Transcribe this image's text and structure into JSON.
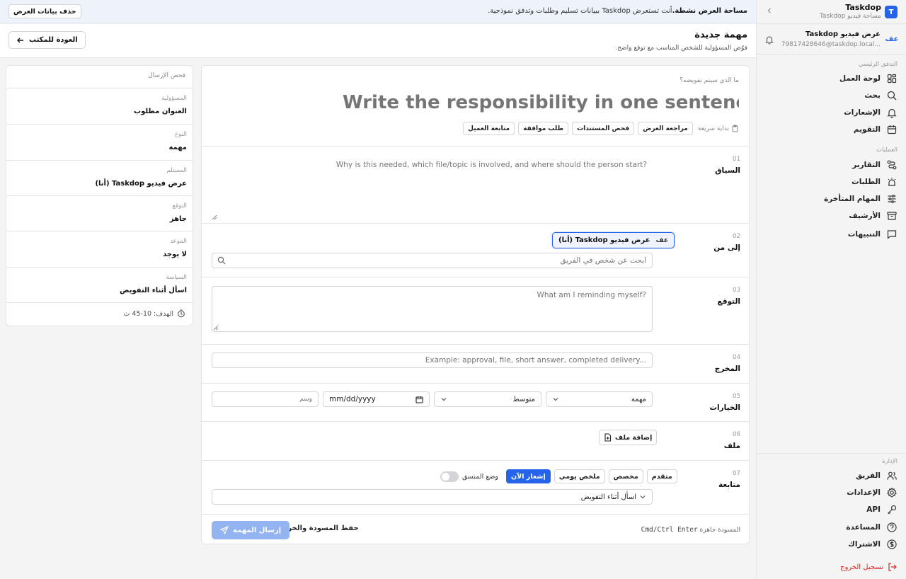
{
  "brand": {
    "initial": "T",
    "name": "Taskdop",
    "subtitle": "مساحة فيديو Taskdop"
  },
  "user": {
    "initials": "عف",
    "name": "عرض فيديو Taskdop",
    "email": "79817428646@taskdop.local..."
  },
  "sidebar": {
    "section_main": "التدفق الرئيسي",
    "main_items": [
      {
        "label": "لوحة العمل",
        "icon": "dashboard-icon"
      },
      {
        "label": "بحث",
        "icon": "search-icon"
      },
      {
        "label": "الإشعارات",
        "icon": "bell-icon"
      },
      {
        "label": "التقويم",
        "icon": "calendar-icon"
      }
    ],
    "section_ops": "العمليات",
    "ops_items": [
      {
        "label": "التقارير",
        "icon": "route-icon"
      },
      {
        "label": "الطلبات",
        "icon": "alarm-icon"
      },
      {
        "label": "المهام المتأخرة",
        "icon": "sliders-icon"
      },
      {
        "label": "الأرشيف",
        "icon": "archive-icon"
      },
      {
        "label": "التنبيهات",
        "icon": "message-icon"
      }
    ],
    "section_admin": "الإدارة",
    "admin_items": [
      {
        "label": "الفريق",
        "icon": "users-icon"
      },
      {
        "label": "الإعدادات",
        "icon": "gear-icon"
      },
      {
        "label": "API",
        "icon": "key-icon"
      },
      {
        "label": "المساعدة",
        "icon": "help-icon"
      },
      {
        "label": "الاشتراك",
        "icon": "dollar-icon"
      }
    ],
    "logout": "تسجيل الخروج"
  },
  "banner": {
    "title": "مساحة العرض نشطة.",
    "text": "أنت تستعرض Taskdop ببيانات تسليم وطلبات وتدفق نموذجية.",
    "clear_button": "حذف بيانات العرض"
  },
  "header": {
    "title": "مهمة جديدة",
    "subtitle": "فوّض المسؤولية للشخص المناسب مع توقع واضح.",
    "back_button": "العودة للمكتب"
  },
  "form": {
    "question": "ما الذي سيتم تفويضه؟",
    "title_placeholder": "Write the responsibility in one sentence...",
    "quick_start_label": "بداية سريعة",
    "quick_chips": [
      "مراجعة العرض",
      "فحص المستندات",
      "طلب موافقة",
      "متابعة العميل"
    ],
    "context": {
      "num": "01",
      "label": "السياق",
      "placeholder": "Why is this needed, which file/topic is involved, and where should the person start?"
    },
    "to": {
      "num": "02",
      "label": "إلى من",
      "selected_initials": "عف",
      "selected_name": "عرض فيديو Taskdop (أنا)",
      "search_placeholder": "ابحث عن شخص في الفريق"
    },
    "expectation": {
      "num": "03",
      "label": "التوقع",
      "placeholder": "What am I reminding myself?"
    },
    "output": {
      "num": "04",
      "label": "المخرج",
      "placeholder": "Example: approval, file, short answer, completed delivery..."
    },
    "options": {
      "num": "05",
      "label": "الخيارات",
      "type_value": "مهمة",
      "priority_value": "متوسط",
      "date_placeholder": "mm/dd/yyyy",
      "tag_placeholder": "وسم"
    },
    "file": {
      "num": "06",
      "label": "ملف",
      "button": "إضافة ملف"
    },
    "followup": {
      "num": "07",
      "label": "متابعة",
      "coordinator_label": "وضع المنسق",
      "modes": [
        "إشعار الآن",
        "ملخص يومي",
        "مخصص",
        "متقدم"
      ],
      "active_mode": 0,
      "policy_value": "اسأل أثناء التفويض"
    },
    "footer": {
      "draft_status": "المسودة جاهزة",
      "shortcut": "Cmd/Ctrl Enter",
      "save_draft": "حفظ المسودة والخروج",
      "send": "إرسال المهمة"
    }
  },
  "summary": {
    "header": "فحص الإرسال",
    "items": [
      {
        "key": "المسؤولية",
        "value": "العنوان مطلوب"
      },
      {
        "key": "النوع",
        "value": "مهمة"
      },
      {
        "key": "المستلم",
        "value": "عرض فيديو Taskdop (أنا)"
      },
      {
        "key": "التوقع",
        "value": "جاهز"
      },
      {
        "key": "الموعد",
        "value": "لا يوجد"
      },
      {
        "key": "السياسة",
        "value": "اسأل أثناء التفويض"
      }
    ],
    "target": "الهدف: 10-45 ث"
  }
}
